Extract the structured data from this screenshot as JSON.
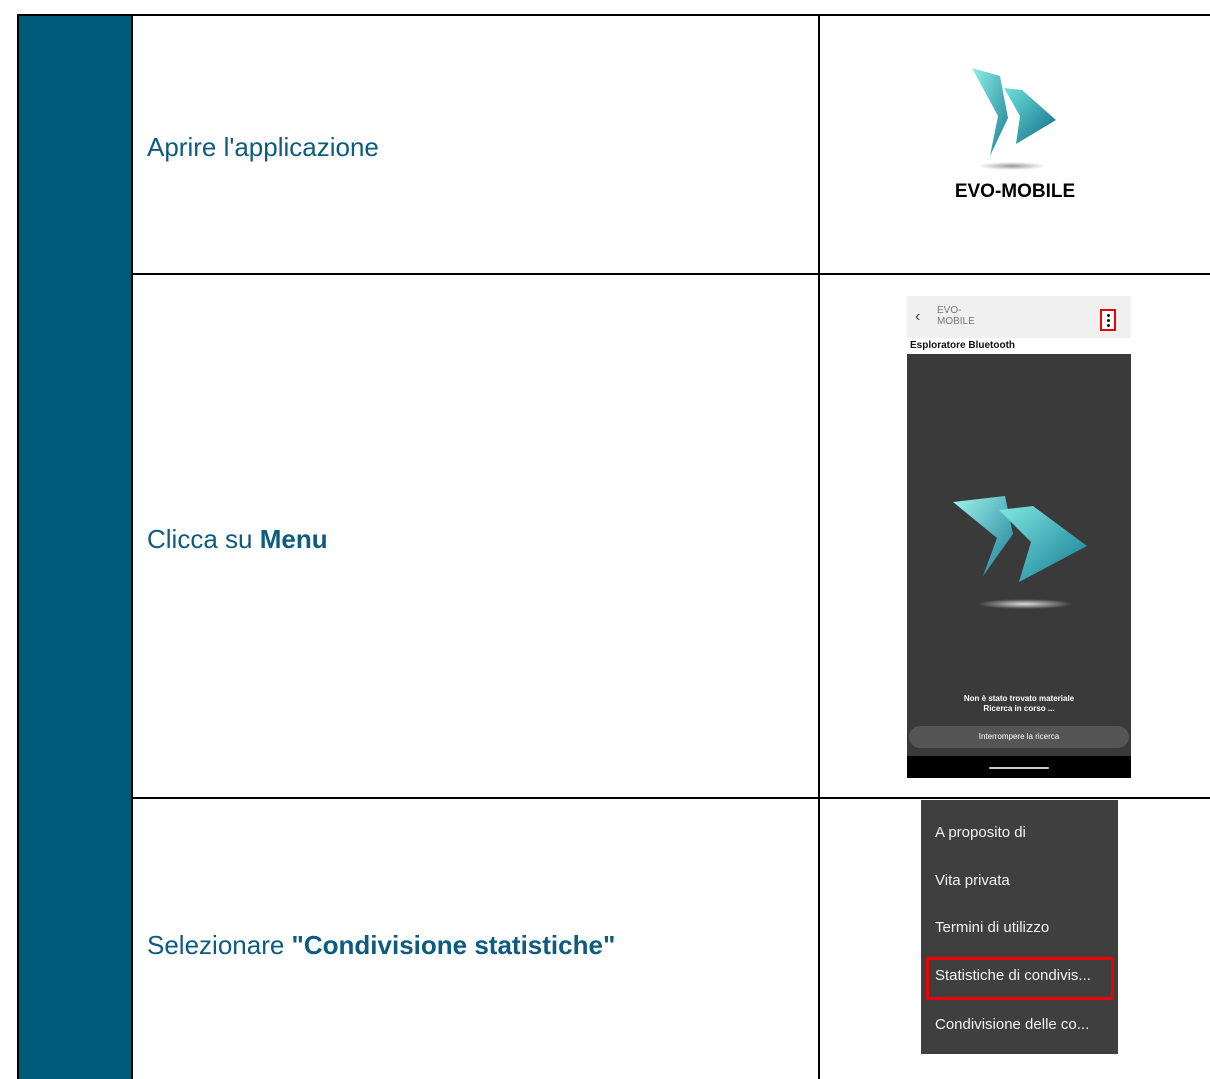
{
  "steps": [
    {
      "text": "Aprire l'applicazione",
      "bold": ""
    },
    {
      "text": "Clicca su ",
      "bold": "Menu"
    },
    {
      "text": "Selezionare ",
      "bold": "\"Condivisione statistiche\""
    }
  ],
  "logo": {
    "caption": "EVO-MOBILE"
  },
  "phone": {
    "back_icon": "chevron-left-icon",
    "app_name_line1": "EVO-",
    "app_name_line2": "MOBILE",
    "menu_icon": "kebab-menu-icon",
    "subtitle": "Esploratore Bluetooth",
    "message_line1": "Non è stato trovato materiale",
    "message_line2": "Ricerca in corso ...",
    "stop_button": "Interrompere la ricerca"
  },
  "menu": {
    "items": [
      "A proposito di",
      "Vita privata",
      "Termini di utilizzo",
      "Statistiche di condivis...",
      "Condivisione delle co..."
    ],
    "highlighted_index": 3
  },
  "colors": {
    "sidebar": "#005a7a",
    "step_text": "#0d5b7e",
    "highlight": "#ee0000",
    "logo_light": "#7fe0e0",
    "logo_dark": "#1a7e95"
  }
}
